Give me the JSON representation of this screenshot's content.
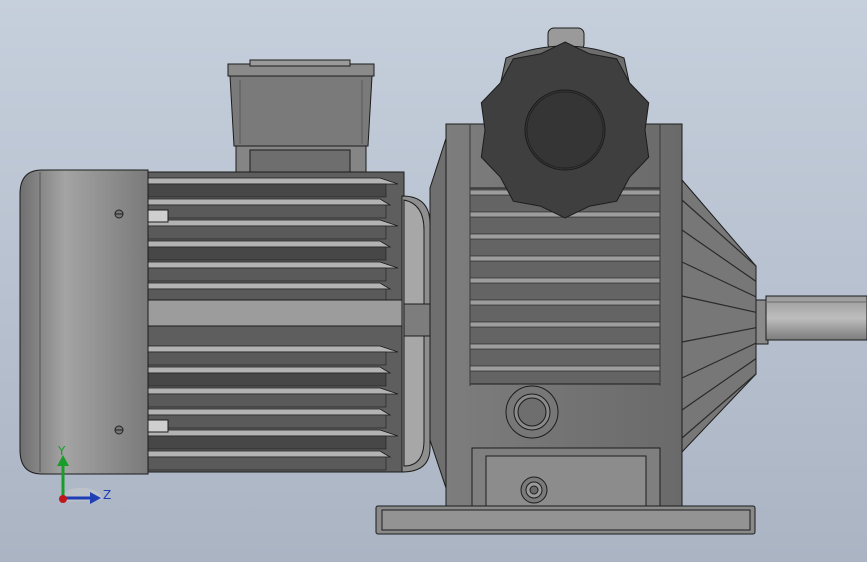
{
  "viewport": {
    "background_top": "#c6cfdc",
    "background_bottom": "#aab4c3"
  },
  "triad": {
    "y_label": "Y",
    "z_label": "Z",
    "y_color": "#1a9c2a",
    "z_color": "#1f3fb5",
    "x_color": "#c0171c"
  },
  "model": {
    "motor_body_color": "#6b6b6b",
    "motor_fin_light": "#b9b9b9",
    "motor_fin_dark": "#4a4a4a",
    "end_cap_color": "#8d8d8d",
    "gearbox_color": "#7a7a7a",
    "handwheel_color": "#3d3d3d",
    "base_color": "#8a8a8a",
    "outline_color": "#1c1c1c"
  }
}
